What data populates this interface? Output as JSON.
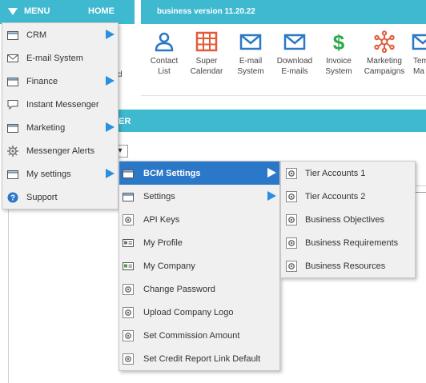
{
  "topbar": {
    "menu_label": "MENU",
    "home_label": "HOME",
    "version": "business version 11.20.22",
    "accent": "#3fb9cf"
  },
  "toolbar": {
    "tools": [
      {
        "line1": "Contact",
        "line2": "List",
        "icon": "person-icon",
        "color": "#2a78c7"
      },
      {
        "line1": "Super",
        "line2": "Calendar",
        "icon": "calendar-grid-icon",
        "color": "#e15b3a"
      },
      {
        "line1": "E-mail",
        "line2": "System",
        "icon": "envelope-icon",
        "color": "#2a78c7"
      },
      {
        "line1": "Download",
        "line2": "E-mails",
        "icon": "envelope-icon",
        "color": "#2a78c7"
      },
      {
        "line1": "Invoice",
        "line2": "System",
        "icon": "dollar-icon",
        "color": "#2aa84a"
      },
      {
        "line1": "Marketing",
        "line2": "Campaigns",
        "icon": "network-icon",
        "color": "#e15b3a"
      },
      {
        "line1": "Tem",
        "line2": "Ma",
        "icon": "envelope-icon",
        "color": "#2a78c7"
      }
    ]
  },
  "page": {
    "side_cut_text": "d",
    "section_title": "ER",
    "select_value": "▾"
  },
  "main_menu": {
    "items": [
      {
        "label": "CRM",
        "icon": "folder-icon",
        "submenu": true
      },
      {
        "label": "E-mail System",
        "icon": "envelope-icon",
        "submenu": false
      },
      {
        "label": "Finance",
        "icon": "folder-icon",
        "submenu": true
      },
      {
        "label": "Instant Messenger",
        "icon": "speech-bubble-icon",
        "submenu": false
      },
      {
        "label": "Marketing",
        "icon": "folder-icon",
        "submenu": true
      },
      {
        "label": "Messenger Alerts",
        "icon": "gear-icon",
        "submenu": false
      },
      {
        "label": "My settings",
        "icon": "folder-icon",
        "submenu": true
      },
      {
        "label": "Support",
        "icon": "help-icon",
        "submenu": false
      }
    ]
  },
  "settings_menu": {
    "items": [
      {
        "label": "BCM Settings",
        "icon": "folder-icon",
        "submenu": true,
        "active": true
      },
      {
        "label": "Settings",
        "icon": "folder-icon",
        "submenu": true
      },
      {
        "label": "API Keys",
        "icon": "gear-icon",
        "submenu": false
      },
      {
        "label": "My Profile",
        "icon": "id-card-icon",
        "submenu": false
      },
      {
        "label": "My Company",
        "icon": "company-card-icon",
        "submenu": false
      },
      {
        "label": "Change Password",
        "icon": "gear-icon",
        "submenu": false
      },
      {
        "label": "Upload Company Logo",
        "icon": "gear-icon",
        "submenu": false
      },
      {
        "label": "Set Commission Amount",
        "icon": "gear-icon",
        "submenu": false
      },
      {
        "label": "Set Credit Report Link Default",
        "icon": "gear-icon",
        "submenu": false
      }
    ]
  },
  "bcm_menu": {
    "items": [
      {
        "label": "Tier Accounts 1",
        "icon": "gear-icon"
      },
      {
        "label": "Tier Accounts 2",
        "icon": "gear-icon"
      },
      {
        "label": "Business Objectives",
        "icon": "gear-icon"
      },
      {
        "label": "Business Requirements",
        "icon": "gear-icon"
      },
      {
        "label": "Business Resources",
        "icon": "gear-icon"
      }
    ]
  },
  "colors": {
    "menu_active": "#2a78c7",
    "submenu_arrow": "#2a8fe0"
  }
}
